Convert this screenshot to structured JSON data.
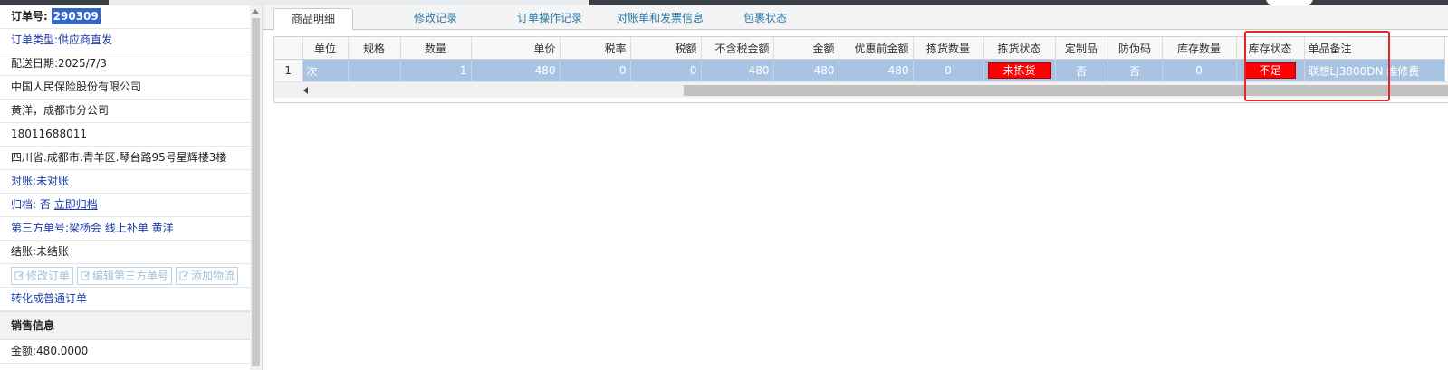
{
  "order": {
    "label": "订单号:",
    "number": "290309",
    "type": "订单类型:供应商直发",
    "delivery_date": "配送日期:2025/7/3",
    "company": "中国人民保险股份有限公司",
    "contact": "黄洋，成都市分公司",
    "phone": "18011688011",
    "address": "四川省.成都市.青羊区.琴台路95号星辉楼3楼",
    "reconcile": "对账:未对账",
    "archive_label": "归档:",
    "archive_status": "否",
    "archive_link": "立即归档",
    "third_party": "第三方单号:梁杨会 线上补单 黄洋",
    "settlement": "结账:未结账",
    "buttons": {
      "edit_order": "修改订单",
      "edit_third": "编辑第三方单号",
      "add_logistics": "添加物流"
    },
    "convert_link": "转化成普通订单"
  },
  "sales": {
    "title": "销售信息",
    "amount": "金额:480.0000"
  },
  "tabs": [
    {
      "label": "商品明细",
      "active": true
    },
    {
      "label": "修改记录",
      "active": false
    },
    {
      "label": "订单操作记录",
      "active": false
    },
    {
      "label": "对账单和发票信息",
      "active": false
    },
    {
      "label": "包裹状态",
      "active": false
    }
  ],
  "grid": {
    "columns": [
      "单位",
      "规格",
      "数量",
      "单价",
      "税率",
      "税额",
      "不含税金额",
      "金额",
      "优惠前金额",
      "拣货数量",
      "拣货状态",
      "定制品",
      "防伪码",
      "库存数量",
      "库存状态",
      "单品备注"
    ],
    "rows": [
      {
        "row_no": "1",
        "unit": "次",
        "spec": "",
        "qty": "1",
        "price": "480",
        "tax_rate": "0",
        "tax_amount": "0",
        "net_amount": "480",
        "amount": "480",
        "pre_discount": "480",
        "pick_qty": "0",
        "pick_status": "未拣货",
        "custom": "否",
        "anti_fake": "否",
        "stock_qty": "0",
        "stock_status": "不足",
        "remark": "联想LJ3800DN 维修费"
      }
    ]
  },
  "colors": {
    "selected_row": "#a9c3e3",
    "alert_red": "#ff0000",
    "link_blue": "#1a3aa6",
    "tab_text": "#2a7aa8",
    "highlight_border": "#e32626"
  }
}
